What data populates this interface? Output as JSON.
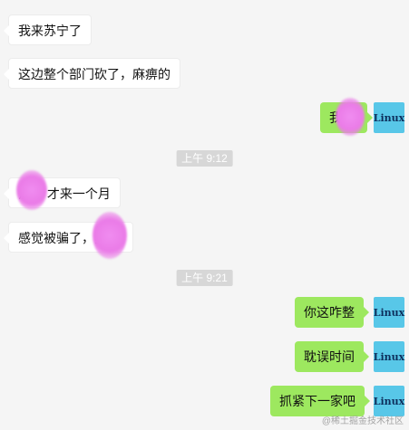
{
  "messages": [
    {
      "side": "left",
      "text": "我来苏宁了"
    },
    {
      "side": "left",
      "text": "这边整个部门砍了，麻痹的"
    },
    {
      "side": "right",
      "text": "我",
      "avatar": "Linux"
    },
    {
      "side": "time",
      "text": "上午 9:12"
    },
    {
      "side": "left",
      "text": "汶  ，才来一个月"
    },
    {
      "side": "left",
      "text": "感觉被骗了，狗   的"
    },
    {
      "side": "time",
      "text": "上午 9:21"
    },
    {
      "side": "right",
      "text": "你这咋整",
      "avatar": "Linux"
    },
    {
      "side": "right",
      "text": "耽误时间",
      "avatar": "Linux"
    },
    {
      "side": "right",
      "text": "抓紧下一家吧",
      "avatar": "Linux"
    }
  ],
  "watermark": "@稀土掘金技术社区",
  "colors": {
    "background": "#f5f5f5",
    "bubble_left": "#ffffff",
    "bubble_right": "#9de85f",
    "avatar_bg": "#58c7e8",
    "time_bg": "#d7d7d7",
    "privacy_blur": "#ea7be7"
  }
}
